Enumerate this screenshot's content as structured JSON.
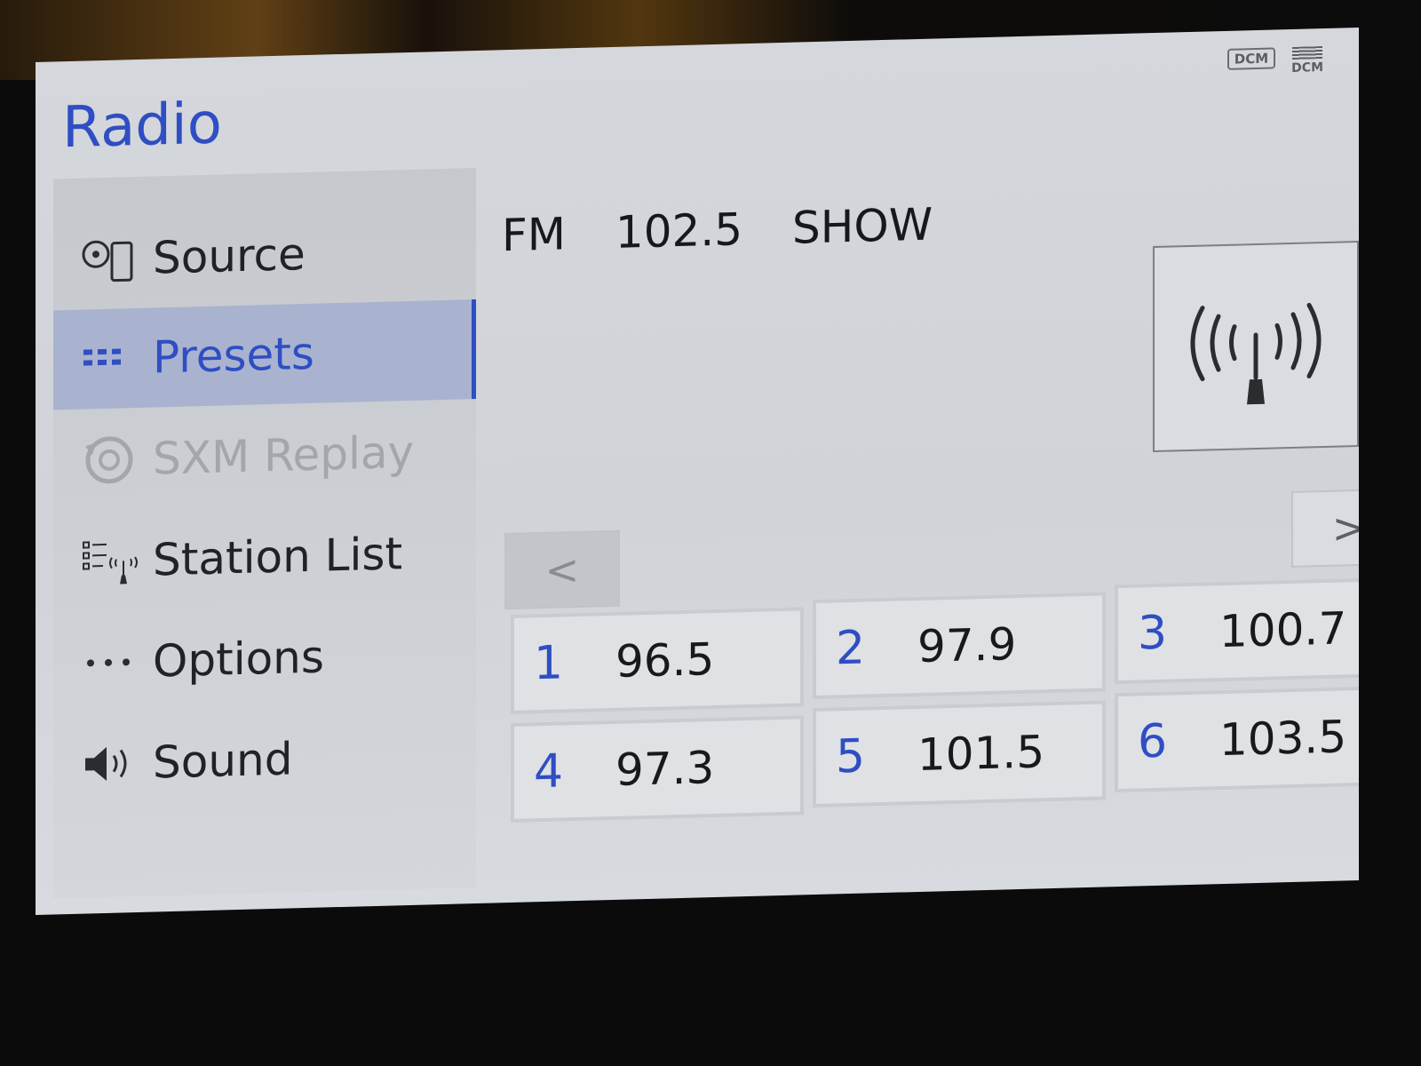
{
  "header": {
    "title": "Radio"
  },
  "status_icons": {
    "dcm_box": "DCM",
    "dcm_signal": "DCM"
  },
  "sidebar": {
    "items": [
      {
        "label": "Source",
        "icon": "source-icon",
        "state": "normal"
      },
      {
        "label": "Presets",
        "icon": "presets-icon",
        "state": "active"
      },
      {
        "label": "SXM Replay",
        "icon": "replay-icon",
        "state": "disabled"
      },
      {
        "label": "Station List",
        "icon": "station-list-icon",
        "state": "normal"
      },
      {
        "label": "Options",
        "icon": "options-icon",
        "state": "normal"
      },
      {
        "label": "Sound",
        "icon": "speaker-icon",
        "state": "normal"
      }
    ]
  },
  "now_playing": {
    "band": "FM",
    "frequency": "102.5",
    "station_name": "SHOW"
  },
  "navigation": {
    "prev": "<",
    "next": ">"
  },
  "presets": [
    {
      "number": "1",
      "frequency": "96.5"
    },
    {
      "number": "2",
      "frequency": "97.9"
    },
    {
      "number": "3",
      "frequency": "100.7"
    },
    {
      "number": "4",
      "frequency": "97.3"
    },
    {
      "number": "5",
      "frequency": "101.5"
    },
    {
      "number": "6",
      "frequency": "103.5"
    }
  ],
  "colors": {
    "accent": "#2f4ec3",
    "screen_bg": "#d2d5da",
    "active_bg": "#a9b3cf"
  }
}
